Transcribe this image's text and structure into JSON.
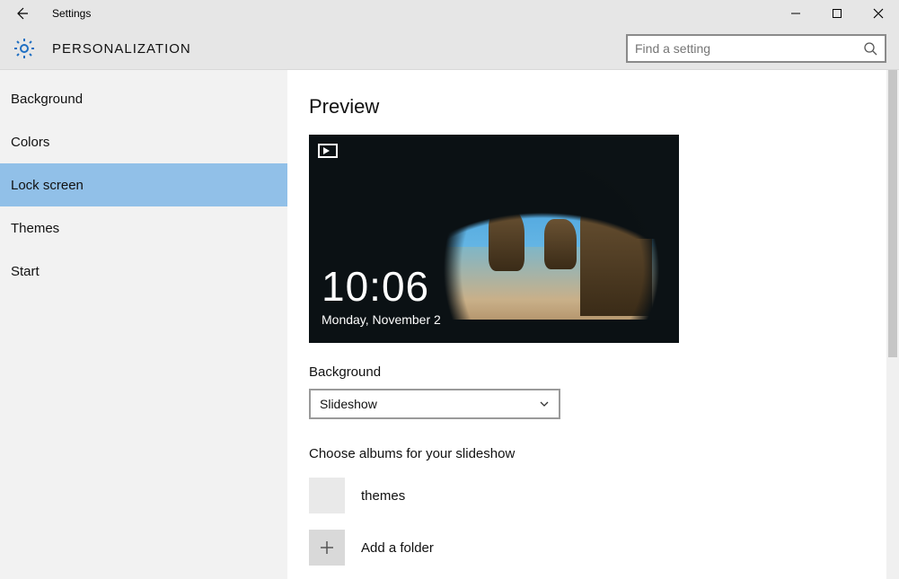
{
  "app_title": "Settings",
  "section_title": "PERSONALIZATION",
  "search": {
    "placeholder": "Find a setting"
  },
  "sidebar": {
    "items": [
      {
        "label": "Background",
        "selected": false
      },
      {
        "label": "Colors",
        "selected": false
      },
      {
        "label": "Lock screen",
        "selected": true
      },
      {
        "label": "Themes",
        "selected": false
      },
      {
        "label": "Start",
        "selected": false
      }
    ]
  },
  "content": {
    "preview_heading": "Preview",
    "lock_time": "10:06",
    "lock_date": "Monday, November 2",
    "background_label": "Background",
    "background_value": "Slideshow",
    "choose_albums_label": "Choose albums for your slideshow",
    "albums": [
      {
        "label": "themes"
      }
    ],
    "add_folder_label": "Add a folder"
  }
}
